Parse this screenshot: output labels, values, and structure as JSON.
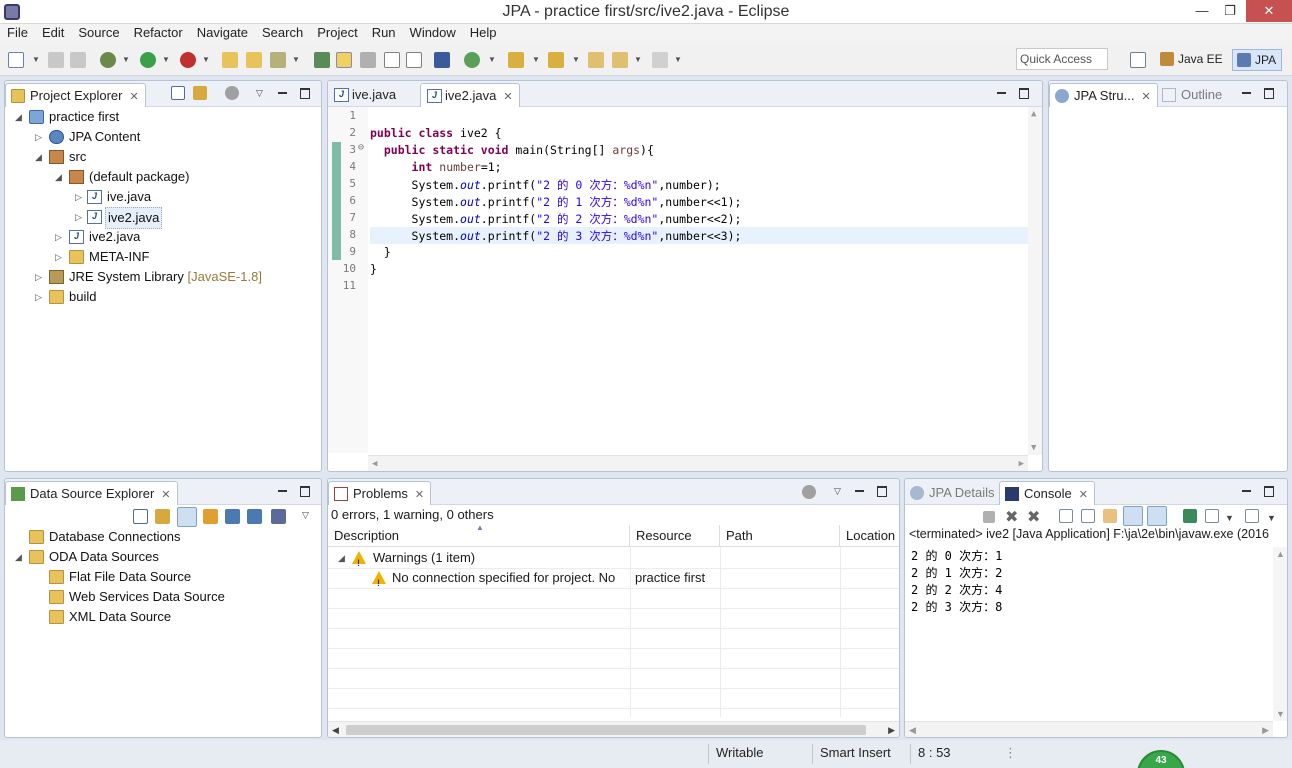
{
  "window": {
    "title": "JPA - practice first/src/ive2.java - Eclipse"
  },
  "menu": [
    "File",
    "Edit",
    "Source",
    "Refactor",
    "Navigate",
    "Search",
    "Project",
    "Run",
    "Window",
    "Help"
  ],
  "toolbar": {
    "quick_access_placeholder": "Quick Access",
    "perspectives": [
      "Java EE",
      "JPA"
    ]
  },
  "project_explorer": {
    "title": "Project Explorer",
    "tree": [
      {
        "label": "practice first"
      },
      {
        "label": "JPA Content"
      },
      {
        "label": "src"
      },
      {
        "label": "(default package)"
      },
      {
        "label": "ive.java"
      },
      {
        "label": "ive2.java"
      },
      {
        "label": "ive2.java"
      },
      {
        "label": "META-INF"
      },
      {
        "label": "JRE System Library"
      },
      {
        "label": "build"
      }
    ],
    "jre_suffix": "[JavaSE-1.8]"
  },
  "editor": {
    "tabs": [
      "ive.java",
      "ive2.java"
    ],
    "line_numbers": [
      "1",
      "2",
      "3",
      "4",
      "5",
      "6",
      "7",
      "8",
      "9",
      "10",
      "11"
    ],
    "fold_marker": "⊖",
    "code": {
      "l2_kw": "public class",
      "l2_rest": " ive2 {",
      "l3_kw": "public static void",
      "l3_rest": " main(String[] ",
      "l3_var": "args",
      "l3_end": "){",
      "l4_kw": "int",
      "l4_var": "number",
      "l4_end": "=1;",
      "printf_prefix": "System.",
      "printf_field": "out",
      "printf_call": ".printf(",
      "l5_str": "\"2 的 0 次方：%d%n\"",
      "l5_end": ",number);",
      "l6_str": "\"2 的 1 次方：%d%n\"",
      "l6_end": ",number<<1);",
      "l7_str": "\"2 的 2 次方：%d%n\"",
      "l7_end": ",number<<2);",
      "l8_str": "\"2 的 3 次方：%d%n\"",
      "l8_end": ",number<<3);",
      "l9": "}",
      "l10": "}"
    }
  },
  "right_panel": {
    "tabs": [
      "JPA Stru...",
      "Outline"
    ]
  },
  "data_source_explorer": {
    "title": "Data Source Explorer",
    "tree": [
      {
        "label": "Database Connections"
      },
      {
        "label": "ODA Data Sources"
      },
      {
        "label": "Flat File Data Source"
      },
      {
        "label": "Web Services Data Source"
      },
      {
        "label": "XML Data Source"
      }
    ]
  },
  "problems": {
    "title": "Problems",
    "summary": "0 errors, 1 warning, 0 others",
    "columns": [
      "Description",
      "Resource",
      "Path",
      "Location"
    ],
    "group": "Warnings (1 item)",
    "row": {
      "description": "No connection specified for project. No",
      "resource": "practice first"
    }
  },
  "console": {
    "tabs": [
      "JPA Details",
      "Console"
    ],
    "header": "<terminated> ive2 [Java Application] F:\\ja\\2e\\bin\\javaw.exe (2016",
    "lines": [
      "2 的 0 次方：1",
      "2 的 1 次方：2",
      "2 的 2 次方：4",
      "2 的 3 次方：8"
    ]
  },
  "status": {
    "writable": "Writable",
    "insert_mode": "Smart Insert",
    "position": "8 : 53",
    "heap": "43"
  },
  "colors": {
    "keyword": "#7f0055",
    "string": "#2a00ff",
    "field": "#0000c0",
    "accent": "#d8e6f8"
  }
}
